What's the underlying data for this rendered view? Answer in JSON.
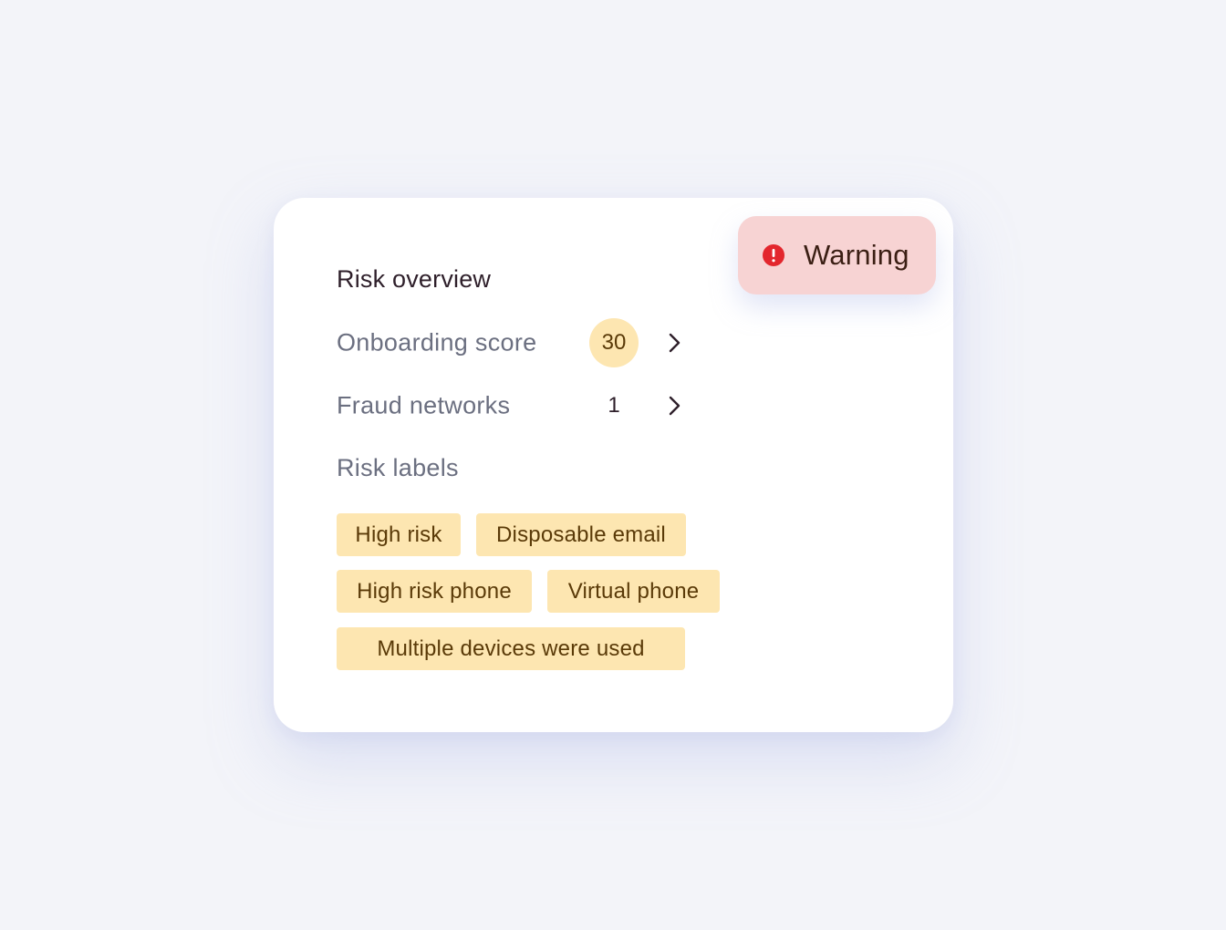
{
  "card": {
    "title": "Risk overview",
    "rows": [
      {
        "label": "Onboarding score",
        "value": "30"
      },
      {
        "label": "Fraud networks",
        "value": "1"
      }
    ],
    "risk_labels_title": "Risk labels",
    "tags": [
      "High risk",
      "Disposable email",
      "High risk phone",
      "Virtual phone",
      "Multiple devices were used"
    ]
  },
  "warning": {
    "label": "Warning",
    "icon": "exclamation-circle-icon"
  },
  "colors": {
    "background": "#f3f4f9",
    "card": "#ffffff",
    "tag_bg": "#fde6b1",
    "tag_text": "#5a3a08",
    "warning_bg": "#f7d3d3",
    "warning_icon": "#e3262d"
  }
}
